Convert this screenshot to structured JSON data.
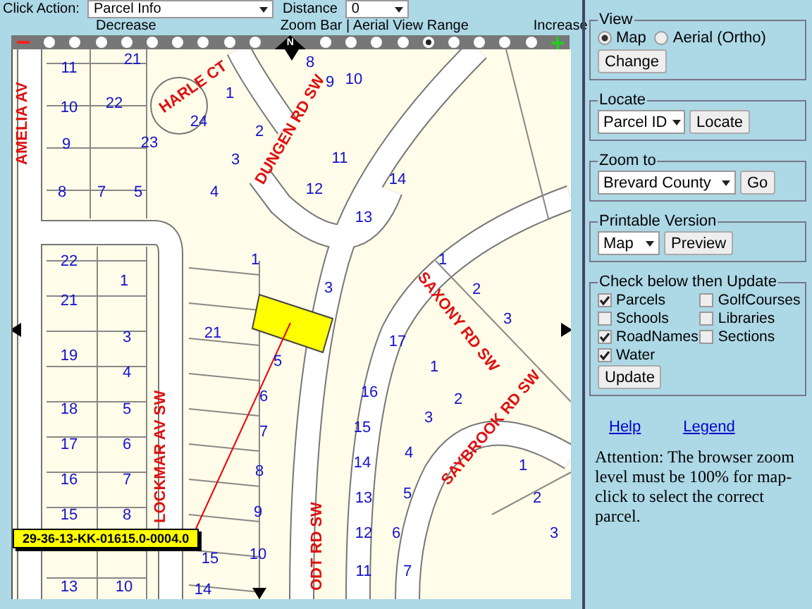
{
  "toolbar": {
    "click_action_label": "Click Action:",
    "click_action_value": "Parcel Info",
    "distance_label": "Distance",
    "distance_value": "0"
  },
  "zoom_bar": {
    "decrease_label": "Decrease",
    "title": "Zoom Bar | Aerial View Range",
    "increase_label": "Increase",
    "north_label": "N",
    "steps": [
      {
        "selected": false
      },
      {
        "selected": false
      },
      {
        "selected": false
      },
      {
        "selected": false
      },
      {
        "selected": false
      },
      {
        "selected": false
      },
      {
        "selected": false
      },
      {
        "selected": false
      },
      {
        "selected": false
      },
      {
        "selected": false
      },
      {
        "selected": false
      },
      {
        "selected": false
      },
      {
        "selected": false
      },
      {
        "selected": true
      },
      {
        "selected": false
      },
      {
        "selected": false
      },
      {
        "selected": false
      },
      {
        "selected": false
      }
    ]
  },
  "map": {
    "lots": [
      "21",
      "8",
      "11",
      "9",
      "10",
      "1",
      "22",
      "10",
      "24",
      "2",
      "9",
      "23",
      "11",
      "3",
      "8",
      "7",
      "5",
      "4",
      "12",
      "14",
      "13",
      "22",
      "1",
      "1",
      "1",
      "3",
      "2",
      "21",
      "21",
      "3",
      "17",
      "3",
      "5",
      "19",
      "4",
      "1",
      "6",
      "16",
      "2",
      "18",
      "5",
      "3",
      "7",
      "15",
      "17",
      "6",
      "4",
      "14",
      "8",
      "16",
      "7",
      "13",
      "5",
      "15",
      "8",
      "9",
      "12",
      "6",
      "15",
      "10",
      "11",
      "7",
      "13",
      "10",
      "14",
      "1",
      "2",
      "3"
    ],
    "roads": [
      "AMELIA AV",
      "HARLE CT",
      "DUNGEN RD SW",
      "LOCKMAR AV SW",
      "ODT RD SW",
      "SAXONY RD SW",
      "SAYBROOK RD SW"
    ],
    "parcel_id": "29-36-13-KK-01615.0-0004.0"
  },
  "panel": {
    "view": {
      "legend": "View",
      "options": [
        {
          "label": "Map",
          "selected": true
        },
        {
          "label": "Aerial (Ortho)",
          "selected": false
        }
      ],
      "button": "Change"
    },
    "locate": {
      "legend": "Locate",
      "select": "Parcel ID",
      "button": "Locate"
    },
    "zoom_to": {
      "legend": "Zoom to",
      "select": "Brevard County",
      "button": "Go"
    },
    "printable": {
      "legend": "Printable Version",
      "select": "Map",
      "button": "Preview"
    },
    "layers": {
      "legend": "Check below then Update",
      "items": [
        {
          "label": "Parcels",
          "checked": true
        },
        {
          "label": "GolfCourses",
          "checked": false
        },
        {
          "label": "Schools",
          "checked": false
        },
        {
          "label": "Libraries",
          "checked": false
        },
        {
          "label": "RoadNames",
          "checked": true
        },
        {
          "label": "Sections",
          "checked": false
        },
        {
          "label": "Water",
          "checked": true
        }
      ],
      "button": "Update"
    },
    "links": [
      "Help",
      "Legend"
    ],
    "attention": "Attention: The browser zoom level must be 100% for map-click to select the correct parcel."
  }
}
